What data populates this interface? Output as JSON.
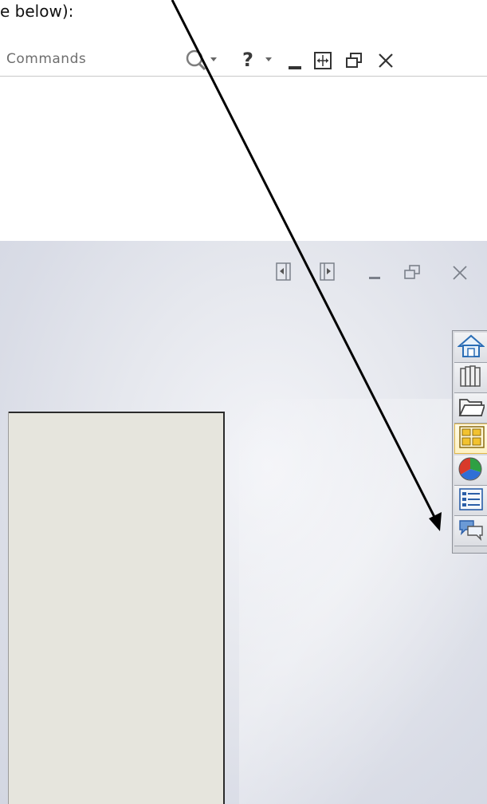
{
  "caption": {
    "text": "e below):"
  },
  "titlebar": {
    "search_text": "Commands",
    "help_label": "?",
    "icons": [
      "search-icon",
      "dropdown-arrow-icon",
      "help-icon",
      "dropdown-arrow-icon",
      "minimize-icon",
      "fit-window-icon",
      "restore-icon",
      "close-icon"
    ]
  },
  "document_window": {
    "buttons": [
      "prev-doc-icon",
      "next-doc-icon",
      "minimize-icon",
      "restore-icon",
      "close-icon"
    ]
  },
  "task_pane": {
    "tabs": [
      {
        "icon": "home-icon",
        "name": "solidworks-resources"
      },
      {
        "icon": "design-library-icon",
        "name": "design-library"
      },
      {
        "icon": "folder-icon",
        "name": "file-explorer"
      },
      {
        "icon": "view-palette-icon",
        "name": "view-palette",
        "active": true
      },
      {
        "icon": "appearances-icon",
        "name": "appearances-scenes"
      },
      {
        "icon": "custom-properties-icon",
        "name": "custom-properties"
      },
      {
        "icon": "forum-icon",
        "name": "forum"
      }
    ],
    "active_accent": "#e3b94a"
  },
  "colors": {
    "sheet_fill": "#e6e5dd",
    "graphics_bg": "#dfe2ea",
    "arrow": "#000000"
  }
}
